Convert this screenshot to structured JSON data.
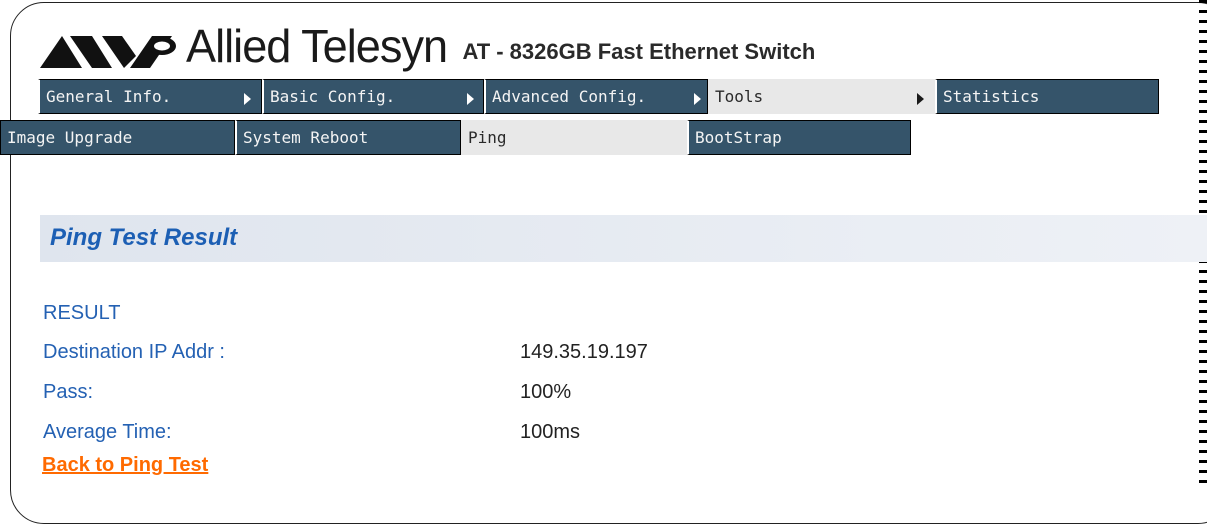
{
  "brand": {
    "name": "Allied Telesyn",
    "model": "AT - 8326GB Fast Ethernet Switch"
  },
  "main_menu": [
    {
      "label": "General Info.",
      "has_arrow": true,
      "active": false
    },
    {
      "label": "Basic Config.",
      "has_arrow": true,
      "active": false
    },
    {
      "label": "Advanced Config.",
      "has_arrow": true,
      "active": false
    },
    {
      "label": "Tools",
      "has_arrow": true,
      "active": true
    },
    {
      "label": "Statistics",
      "has_arrow": false,
      "active": false
    }
  ],
  "sub_menu": [
    {
      "label": "Image Upgrade",
      "active": false
    },
    {
      "label": "System Reboot",
      "active": false
    },
    {
      "label": "Ping",
      "active": true
    },
    {
      "label": "BootStrap",
      "active": false
    }
  ],
  "section": {
    "title": "Ping Test Result"
  },
  "result": {
    "heading": "RESULT",
    "rows": [
      {
        "label": "Destination IP Addr :",
        "value": "149.35.19.197"
      },
      {
        "label": "Pass:",
        "value": "100%"
      },
      {
        "label": "Average Time:",
        "value": "100ms"
      }
    ]
  },
  "back_link": "Back to Ping Test",
  "colors": {
    "tab": "#35546a",
    "tab_active": "#e8e8e8",
    "label": "#2461b3",
    "link": "#ff6a00"
  }
}
